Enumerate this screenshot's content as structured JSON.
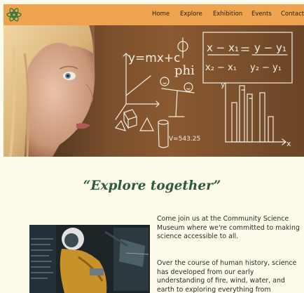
{
  "nav": {
    "items": [
      {
        "label": "Home"
      },
      {
        "label": "Explore"
      },
      {
        "label": "Exhibition"
      },
      {
        "label": "Events"
      },
      {
        "label": "Contact"
      }
    ]
  },
  "hero": {
    "board_text": {
      "linear_eq": "y=mx+c",
      "phi": "phi",
      "slope_lhs": "x − x₁",
      "slope_lhs_den": "x₂ − x₁",
      "slope_rhs": "y − y₁",
      "slope_rhs_den": "y₂ − y₁",
      "vol": "V=543.25",
      "axis_y": "y",
      "axis_x": "x"
    }
  },
  "main": {
    "tagline": "“Explore together”",
    "paragraph_1": "Come join us at the Community Science Museum where we're committed to making science accessible to all.",
    "paragraph_2": "Over the course of human history, science has developed from our early understanding of fire, wind, water, and earth to exploring everything from"
  },
  "colors": {
    "nav_bg": "#eea350",
    "page_bg": "#fdfbea",
    "tagline": "#2e5a41",
    "logo_green": "#2f7a3b"
  }
}
